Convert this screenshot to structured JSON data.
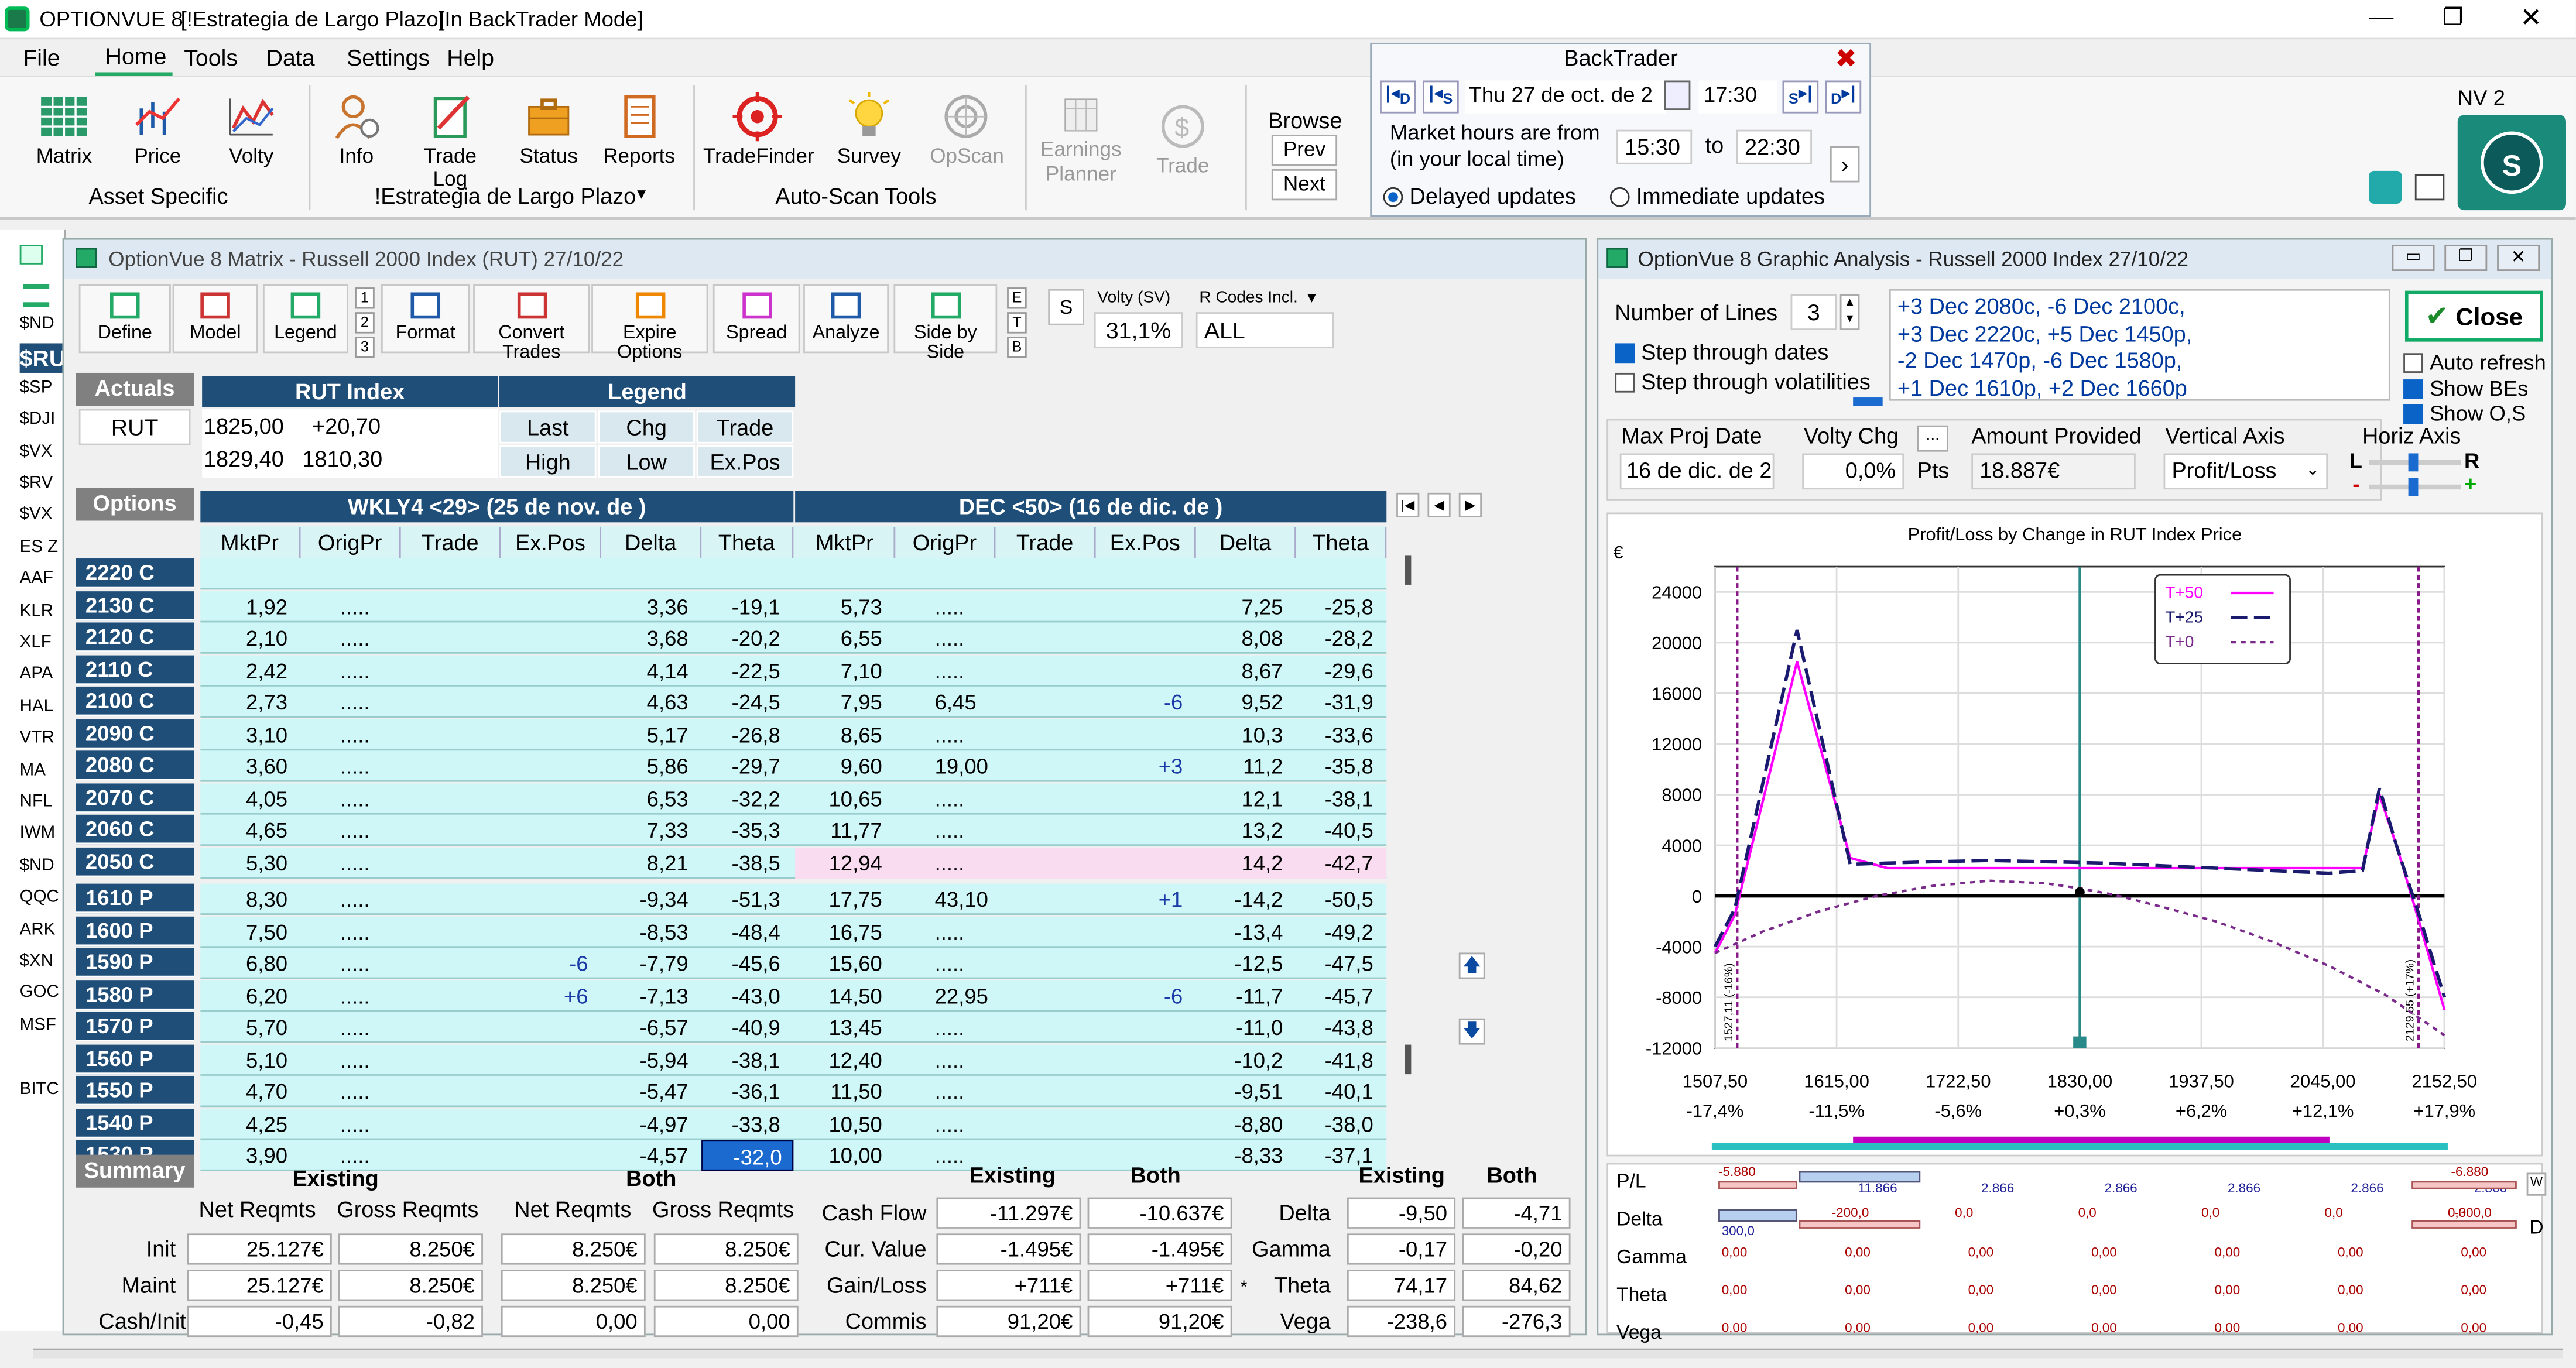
{
  "app": {
    "title": "OPTIONVUE 8",
    "strategy_tag": "[!Estrategia de Largo Plazo]",
    "mode_tag": "[In BackTrader Mode]",
    "nv": "NV 2"
  },
  "menu": [
    "File",
    "Home",
    "Tools",
    "Data",
    "Settings",
    "Help"
  ],
  "ribbon": {
    "buttons": [
      "Matrix",
      "Price",
      "Volty",
      "Info",
      "Trade Log",
      "Status",
      "Reports",
      "TradeFinder",
      "Survey",
      "OpScan",
      "Earnings",
      "Planner",
      "Trade"
    ],
    "groups": [
      "Asset Specific",
      "!Estrategia de Largo Plazo",
      "Auto-Scan Tools"
    ],
    "browse": {
      "label": "Browse",
      "prev": "Prev",
      "next": "Next"
    }
  },
  "backtrader": {
    "title": "BackTrader",
    "date": "Thu 27 de oct. de 2",
    "time": "17:30",
    "hours_label_1": "Market hours are from",
    "hours_label_2": "(in your local time)",
    "from": "15:30",
    "to_word": "to",
    "to": "22:30",
    "delayed": "Delayed updates",
    "immediate": "Immediate updates",
    "nav": [
      "D",
      "S",
      "S",
      "D"
    ]
  },
  "sidebar_symbols": [
    "$ND",
    "$RU",
    "$SP",
    "$DJI",
    "$VX",
    "$RV",
    "$VX",
    "ES Z",
    "AAF",
    "KLR",
    "XLF",
    "APA",
    "HAL",
    "VTR",
    "MA",
    "NFL",
    "IWM",
    "$ND",
    "QQC",
    "ARK",
    "$XN",
    "GOC",
    "MSF",
    "BITC"
  ],
  "matrix": {
    "title": "OptionVue 8 Matrix - Russell 2000 Index (RUT)  27/10/22",
    "toolbar": [
      "Define",
      "Model",
      "Legend",
      "Format",
      "Convert Trades",
      "Expire Options",
      "Spread",
      "Analyze",
      "Side by Side"
    ],
    "nums": [
      "1",
      "2",
      "3"
    ],
    "etb": [
      "E",
      "T",
      "B"
    ],
    "s_btn": "S",
    "volty_label": "Volty (SV)",
    "volty_value": "31,1%",
    "rcodes_label": "R Codes Incl.",
    "rcodes_value": "ALL",
    "actuals_label": "Actuals",
    "actuals_symbol": "RUT",
    "index_header": "RUT Index",
    "index_vals": [
      "1825,00",
      "+20,70",
      "1829,40",
      "1810,30"
    ],
    "legend_header": "Legend",
    "legend_cells": [
      "Last",
      "Chg",
      "Trade",
      "High",
      "Low",
      "Ex.Pos"
    ],
    "options_label": "Options",
    "exp1": "WKLY4 <29> (25 de nov. de )",
    "exp2": "DEC <50> (16 de dic. de )",
    "col_headers": [
      "MktPr",
      "OrigPr",
      "Trade",
      "Ex.Pos",
      "Delta",
      "Theta",
      "MktPr",
      "OrigPr",
      "Trade",
      "Ex.Pos",
      "Delta",
      "Theta"
    ],
    "rows": [
      {
        "label": "2220 C",
        "v": [
          "",
          "",
          "",
          "",
          "",
          "",
          "",
          "",
          "",
          "",
          "",
          ""
        ]
      },
      {
        "label": "2130 C",
        "v": [
          "1,92",
          ".....",
          "",
          "",
          "3,36",
          "-19,1",
          "5,73",
          ".....",
          "",
          "",
          "7,25",
          "-25,8"
        ]
      },
      {
        "label": "2120 C",
        "v": [
          "2,10",
          ".....",
          "",
          "",
          "3,68",
          "-20,2",
          "6,55",
          ".....",
          "",
          "",
          "8,08",
          "-28,2"
        ]
      },
      {
        "label": "2110 C",
        "v": [
          "2,42",
          ".....",
          "",
          "",
          "4,14",
          "-22,5",
          "7,10",
          ".....",
          "",
          "",
          "8,67",
          "-29,6"
        ]
      },
      {
        "label": "2100 C",
        "v": [
          "2,73",
          ".....",
          "",
          "",
          "4,63",
          "-24,5",
          "7,95",
          "6,45",
          "",
          "-6",
          "9,52",
          "-31,9"
        ]
      },
      {
        "label": "2090 C",
        "v": [
          "3,10",
          ".....",
          "",
          "",
          "5,17",
          "-26,8",
          "8,65",
          ".....",
          "",
          "",
          "10,3",
          "-33,6"
        ]
      },
      {
        "label": "2080 C",
        "v": [
          "3,60",
          ".....",
          "",
          "",
          "5,86",
          "-29,7",
          "9,60",
          "19,00",
          "",
          "+3",
          "11,2",
          "-35,8"
        ]
      },
      {
        "label": "2070 C",
        "v": [
          "4,05",
          ".....",
          "",
          "",
          "6,53",
          "-32,2",
          "10,65",
          ".....",
          "",
          "",
          "12,1",
          "-38,1"
        ]
      },
      {
        "label": "2060 C",
        "v": [
          "4,65",
          ".....",
          "",
          "",
          "7,33",
          "-35,3",
          "11,77",
          ".....",
          "",
          "",
          "13,2",
          "-40,5"
        ]
      },
      {
        "label": "2050 C",
        "v": [
          "5,30",
          ".....",
          "",
          "",
          "8,21",
          "-38,5",
          "12,94",
          ".....",
          "",
          "",
          "14,2",
          "-42,7"
        ]
      },
      {
        "label": "1610 P",
        "v": [
          "8,30",
          ".....",
          "",
          "",
          "-9,34",
          "-51,3",
          "17,75",
          "43,10",
          "",
          "+1",
          "-14,2",
          "-50,5"
        ]
      },
      {
        "label": "1600 P",
        "v": [
          "7,50",
          ".....",
          "",
          "",
          "-8,53",
          "-48,4",
          "16,75",
          ".....",
          "",
          "",
          "-13,4",
          "-49,2"
        ]
      },
      {
        "label": "1590 P",
        "v": [
          "6,80",
          ".....",
          "",
          "-6",
          "-7,79",
          "-45,6",
          "15,60",
          ".....",
          "",
          "",
          "-12,5",
          "-47,5"
        ]
      },
      {
        "label": "1580 P",
        "v": [
          "6,20",
          ".....",
          "",
          "+6",
          "-7,13",
          "-43,0",
          "14,50",
          "22,95",
          "",
          "-6",
          "-11,7",
          "-45,7"
        ]
      },
      {
        "label": "1570 P",
        "v": [
          "5,70",
          ".....",
          "",
          "",
          "-6,57",
          "-40,9",
          "13,45",
          ".....",
          "",
          "",
          "-11,0",
          "-43,8"
        ]
      },
      {
        "label": "1560 P",
        "v": [
          "5,10",
          ".....",
          "",
          "",
          "-5,94",
          "-38,1",
          "12,40",
          ".....",
          "",
          "",
          "-10,2",
          "-41,8"
        ]
      },
      {
        "label": "1550 P",
        "v": [
          "4,70",
          ".....",
          "",
          "",
          "-5,47",
          "-36,1",
          "11,50",
          ".....",
          "",
          "",
          "-9,51",
          "-40,1"
        ]
      },
      {
        "label": "1540 P",
        "v": [
          "4,25",
          ".....",
          "",
          "",
          "-4,97",
          "-33,8",
          "10,50",
          ".....",
          "",
          "",
          "-8,80",
          "-38,0"
        ]
      },
      {
        "label": "1530 P",
        "v": [
          "3,90",
          ".....",
          "",
          "",
          "-4,57",
          "-32,0",
          "10,00",
          ".....",
          "",
          "",
          "-8,33",
          "-37,1"
        ]
      }
    ],
    "summary": {
      "label": "Summary",
      "existing": "Existing",
      "both": "Both",
      "net": "Net Reqmts",
      "gross": "Gross Reqmts",
      "row_labels": [
        "Init",
        "Maint",
        "Cash/Init"
      ],
      "existing_net": [
        "25.127€",
        "25.127€",
        "-0,45"
      ],
      "existing_gross": [
        "8.250€",
        "8.250€",
        "-0,82"
      ],
      "both_net": [
        "8.250€",
        "8.250€",
        "0,00"
      ],
      "both_gross": [
        "8.250€",
        "8.250€",
        "0,00"
      ],
      "cf_labels": [
        "Cash Flow",
        "Cur. Value",
        "Gain/Loss",
        "Commis"
      ],
      "cf_existing": [
        "-11.297€",
        "-1.495€",
        "+711€",
        "91,20€"
      ],
      "cf_both": [
        "-10.637€",
        "-1.495€",
        "+711€",
        "91,20€"
      ],
      "greek_labels": [
        "Delta",
        "Gamma",
        "Theta",
        "Vega"
      ],
      "greek_existing": [
        "-9,50",
        "-0,17",
        "74,17",
        "-238,6"
      ],
      "greek_both": [
        "-4,71",
        "-0,20",
        "84,62",
        "-276,3"
      ],
      "star": "*"
    }
  },
  "graph": {
    "title": "OptionVue 8 Graphic Analysis - Russell 2000 Index  27/10/22",
    "num_lines_label": "Number of Lines",
    "num_lines": "3",
    "step_dates": "Step through dates",
    "step_volty": "Step through volatilities",
    "positions": [
      "+3 Dec 2080c, -6 Dec 2100c,",
      "+3 Dec 2220c, +5 Dec 1450p,",
      "-2 Dec 1470p, -6 Dec 1580p,",
      "+1 Dec 1610p, +2 Dec 1660p"
    ],
    "close": "Close",
    "auto_refresh": "Auto refresh",
    "show_bes": "Show BEs",
    "show_os": "Show O,S",
    "max_proj_label": "Max Proj Date",
    "max_proj": "16 de dic. de 2",
    "volty_chg_label": "Volty Chg",
    "volty_chg": "0,0%",
    "pts": "Pts",
    "amount_label": "Amount Provided",
    "amount": "18.887€",
    "vaxis_label": "Vertical Axis",
    "vaxis": "Profit/Loss",
    "haxis_label": "Horiz Axis",
    "l": "L",
    "r": "R",
    "minus": "-",
    "plus": "+"
  },
  "chart_data": {
    "type": "line",
    "title": "Profit/Loss by Change in RUT Index Price",
    "ylabel": "€",
    "ylim": [
      -12000,
      26000
    ],
    "xlim": [
      1507.5,
      2152.5
    ],
    "y_ticks": [
      24000,
      20000,
      16000,
      12000,
      8000,
      4000,
      0,
      -4000,
      -8000,
      -12000
    ],
    "x_ticks": [
      "1507,50",
      "1615,00",
      "1722,50",
      "1830,00",
      "1937,50",
      "2045,00",
      "2152,50"
    ],
    "x_tick_values": [
      1507.5,
      1615,
      1722.5,
      1830,
      1937.5,
      2045,
      2152.5
    ],
    "x_pct": [
      "-17,4%",
      "-11,5%",
      "-5,6%",
      "+0,3%",
      "+6,2%",
      "+12,1%",
      "+17,9%"
    ],
    "be_labels": [
      "1527,11 (-16%)",
      "2129,55 (+17%)"
    ],
    "be_values": [
      1527.11,
      2129.55
    ],
    "current": 1830,
    "series": [
      {
        "name": "T+50",
        "color": "#ff00ff",
        "x": [
          1507.5,
          1525,
          1580,
          1627,
          1660,
          1700,
          1750,
          1800,
          1850,
          1900,
          1950,
          2000,
          2050,
          2080,
          2095,
          2110,
          2130,
          2152.5
        ],
        "y": [
          -4500,
          -1500,
          18500,
          3000,
          2200,
          2200,
          2200,
          2200,
          2200,
          2200,
          2200,
          2200,
          2200,
          2200,
          8000,
          4000,
          -2000,
          -9000
        ]
      },
      {
        "name": "T+25",
        "color": "#1a1a6e",
        "x": [
          1507.5,
          1525,
          1580,
          1627,
          1660,
          1700,
          1750,
          1800,
          1850,
          1900,
          1950,
          2000,
          2050,
          2080,
          2095,
          2110,
          2130,
          2152.5
        ],
        "y": [
          -4000,
          -1000,
          21000,
          2500,
          2600,
          2700,
          2800,
          2700,
          2600,
          2400,
          2200,
          2000,
          1800,
          2000,
          8500,
          4000,
          -1500,
          -8000
        ]
      },
      {
        "name": "T+0",
        "color": "#7a2a8a",
        "x": [
          1507.5,
          1550,
          1600,
          1650,
          1700,
          1750,
          1800,
          1830,
          1860,
          1900,
          1950,
          2000,
          2050,
          2100,
          2152.5
        ],
        "y": [
          -4500,
          -2800,
          -1200,
          0,
          800,
          1200,
          1000,
          600,
          100,
          -800,
          -2000,
          -3600,
          -5500,
          -7800,
          -11000
        ]
      }
    ],
    "legend_position": "top-right"
  },
  "stats": {
    "labels": [
      "P/L",
      "Delta",
      "Gamma",
      "Theta",
      "Vega"
    ],
    "pl": [
      "-5.880",
      "11.866",
      "2.866",
      "2.866",
      "2.866",
      "2.866",
      "2.866",
      "2.866",
      "-6.880"
    ],
    "delta": [
      "300,0",
      "-200,0",
      "0,0",
      "0,0",
      "0,0",
      "0,0",
      "0,0",
      "0,0",
      "-300,0"
    ],
    "zeros": "0,00",
    "w": "W",
    "d": "D"
  }
}
